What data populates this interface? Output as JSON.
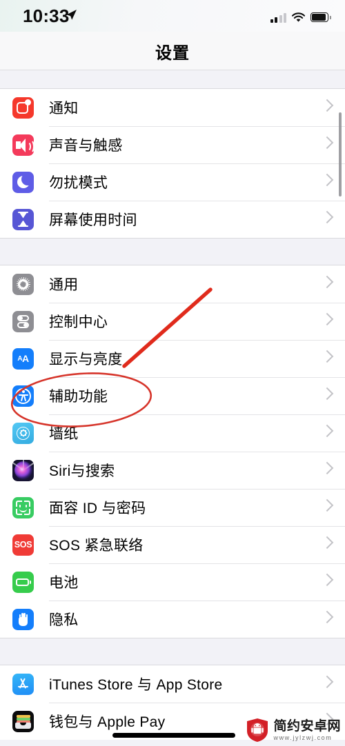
{
  "status_bar": {
    "time": "10:33",
    "location_icon": "location-arrow-icon",
    "signal_icon": "cellular-signal-icon",
    "signal_bars_filled": 2,
    "signal_bars_total": 4,
    "wifi_icon": "wifi-icon",
    "battery_icon": "battery-icon",
    "battery_level": 85
  },
  "header": {
    "title": "设置"
  },
  "groups": [
    {
      "id": "group-1",
      "rows": [
        {
          "label": "通知",
          "icon": "notifications-icon",
          "color": "#f5382b"
        },
        {
          "label": "声音与触感",
          "icon": "sounds-haptics-icon",
          "color": "#f43a5b"
        },
        {
          "label": "勿扰模式",
          "icon": "do-not-disturb-icon",
          "color": "#5e5ce6"
        },
        {
          "label": "屏幕使用时间",
          "icon": "screen-time-icon",
          "color": "#5756d5"
        }
      ]
    },
    {
      "id": "group-2",
      "rows": [
        {
          "label": "通用",
          "icon": "general-gear-icon",
          "color": "#8e8e93"
        },
        {
          "label": "控制中心",
          "icon": "control-center-icon",
          "color": "#8e8e93"
        },
        {
          "label": "显示与亮度",
          "icon": "display-brightness-icon",
          "color": "#147efb"
        },
        {
          "label": "辅助功能",
          "icon": "accessibility-icon",
          "color": "#147efb"
        },
        {
          "label": "墙纸",
          "icon": "wallpaper-icon",
          "color": "#34ace0"
        },
        {
          "label": "Siri与搜索",
          "icon": "siri-search-icon",
          "color": "#1b1740"
        },
        {
          "label": "面容 ID 与密码",
          "icon": "face-id-passcode-icon",
          "color": "#38cc62"
        },
        {
          "label": "SOS 紧急联络",
          "icon": "emergency-sos-icon",
          "color": "#f03b36"
        },
        {
          "label": "电池",
          "icon": "battery-settings-icon",
          "color": "#36cc4c"
        },
        {
          "label": "隐私",
          "icon": "privacy-hand-icon",
          "color": "#147efb"
        }
      ]
    },
    {
      "id": "group-3",
      "rows": [
        {
          "label": "iTunes Store 与 App Store",
          "icon": "app-store-icon",
          "color": "#1f8df6"
        },
        {
          "label": "钱包与 Apple Pay",
          "icon": "wallet-apple-pay-icon",
          "color": "#0b0b0d"
        }
      ]
    }
  ],
  "chevron_icon": "chevron-right-icon",
  "annotations": {
    "highlight_color": "#d6342a",
    "ellipse_target": "辅助功能",
    "arrow": "red-pointer-line",
    "ellipse": "red-ellipse-highlight"
  },
  "watermark": {
    "site_name": "简约安卓网",
    "url": "www.jylzwj.com",
    "logo": "android-shield-logo",
    "logo_color": "#d32027"
  }
}
